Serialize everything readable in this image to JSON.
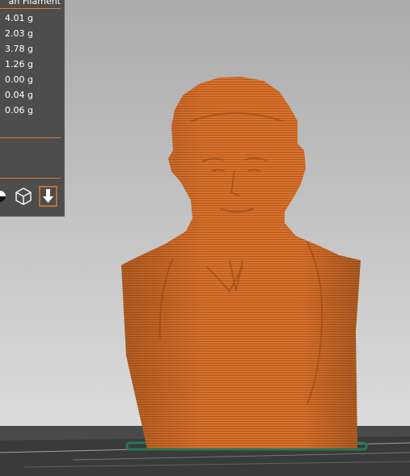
{
  "panel": {
    "header": "an Filament",
    "weights": [
      "4.01 g",
      "2.03 g",
      "3.78 g",
      "1.26 g",
      "0.00 g",
      "0.04 g",
      "0.06 g"
    ]
  },
  "icons": [
    "view-mode-icon",
    "cube-view-icon",
    "export-gcode-icon"
  ],
  "colors": {
    "accent": "#e07a2f",
    "model": "#d8712c",
    "panel": "#4d4d4d",
    "first_layer": "#1f7a55"
  }
}
